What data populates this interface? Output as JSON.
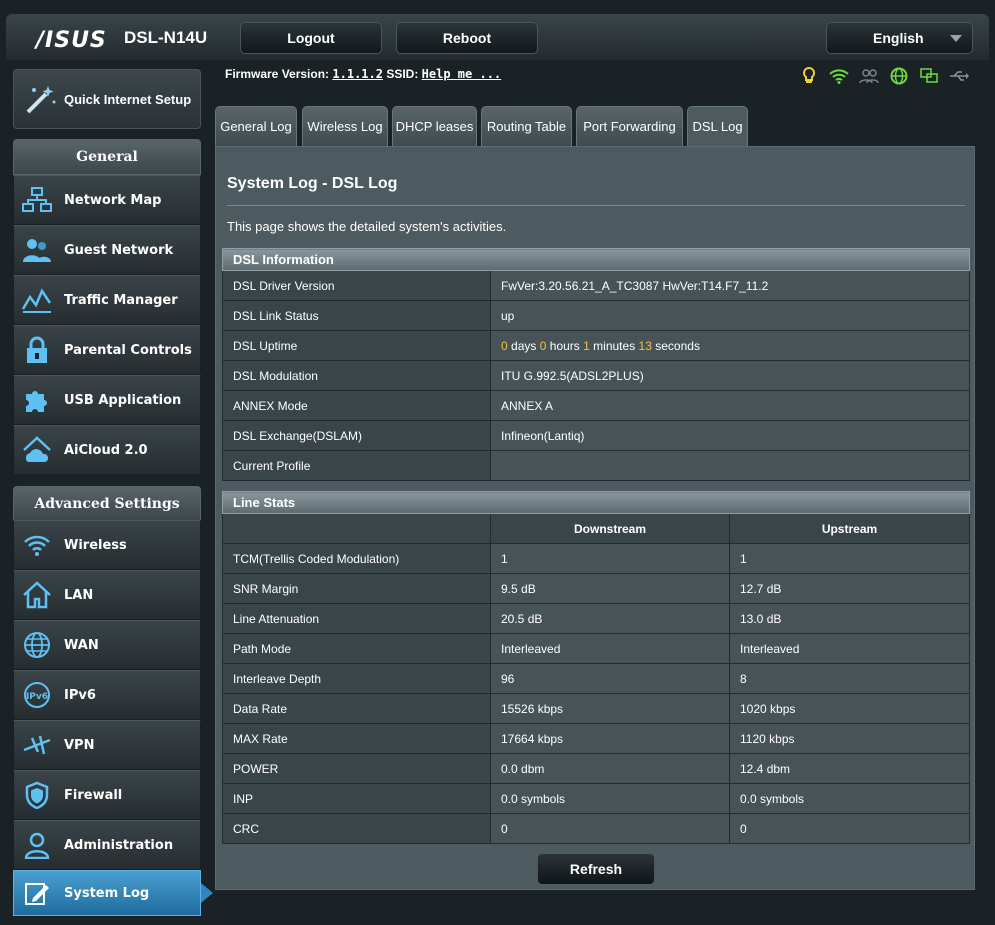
{
  "header": {
    "brand": "/ISUS",
    "model": "DSL-N14U",
    "logout_label": "Logout",
    "reboot_label": "Reboot",
    "language": "English"
  },
  "info_row": {
    "firmware_label": "Firmware Version:",
    "firmware_value": "1.1.1.2",
    "ssid_label": "SSID:",
    "ssid_value": "Help me ..."
  },
  "status_icons": [
    "lightbulb-icon",
    "wifi-icon",
    "clients-icon",
    "internet-globe-icon",
    "network-icon",
    "usb-icon"
  ],
  "sidebar": {
    "quick_setup": "Quick Internet Setup",
    "general_heading": "General",
    "general_items": [
      {
        "label": "Network Map",
        "icon": "network-map-icon"
      },
      {
        "label": "Guest Network",
        "icon": "guest-network-icon"
      },
      {
        "label": "Traffic Manager",
        "icon": "traffic-manager-icon"
      },
      {
        "label": "Parental Controls",
        "icon": "lock-icon"
      },
      {
        "label": "USB Application",
        "icon": "puzzle-icon"
      },
      {
        "label": "AiCloud 2.0",
        "icon": "cloud-icon"
      }
    ],
    "advanced_heading": "Advanced Settings",
    "advanced_items": [
      {
        "label": "Wireless",
        "icon": "wifi-icon"
      },
      {
        "label": "LAN",
        "icon": "home-icon"
      },
      {
        "label": "WAN",
        "icon": "globe-icon"
      },
      {
        "label": "IPv6",
        "icon": "ipv6-icon"
      },
      {
        "label": "VPN",
        "icon": "vpn-icon"
      },
      {
        "label": "Firewall",
        "icon": "shield-icon"
      },
      {
        "label": "Administration",
        "icon": "user-icon"
      },
      {
        "label": "System Log",
        "icon": "log-icon"
      }
    ]
  },
  "tabs": [
    "General Log",
    "Wireless Log",
    "DHCP leases",
    "Routing Table",
    "Port Forwarding",
    "DSL Log"
  ],
  "page": {
    "title": "System Log - DSL Log",
    "description": "This page shows the detailed system's activities."
  },
  "dsl_info": {
    "caption": "DSL Information",
    "rows": [
      {
        "key": "DSL Driver Version",
        "value": "FwVer:3.20.56.21_A_TC3087 HwVer:T14.F7_11.2"
      },
      {
        "key": "DSL Link Status",
        "value": "up"
      },
      {
        "key": "DSL Uptime",
        "value": ""
      },
      {
        "key": "DSL Modulation",
        "value": "ITU G.992.5(ADSL2PLUS)"
      },
      {
        "key": "ANNEX Mode",
        "value": "ANNEX A"
      },
      {
        "key": "DSL Exchange(DSLAM)",
        "value": "Infineon(Lantiq)"
      },
      {
        "key": "Current Profile",
        "value": ""
      }
    ],
    "uptime": {
      "days": "0",
      "days_label": "days",
      "hours": "0",
      "hours_label": "hours",
      "minutes": "1",
      "minutes_label": "minutes",
      "seconds": "13",
      "seconds_label": "seconds"
    }
  },
  "line_stats": {
    "caption": "Line Stats",
    "downstream_label": "Downstream",
    "upstream_label": "Upstream",
    "rows": [
      {
        "key": "TCM(Trellis Coded Modulation)",
        "down": "1",
        "up": "1"
      },
      {
        "key": "SNR Margin",
        "down": "9.5 dB",
        "up": "12.7 dB"
      },
      {
        "key": "Line Attenuation",
        "down": "20.5 dB",
        "up": "13.0 dB"
      },
      {
        "key": "Path Mode",
        "down": "Interleaved",
        "up": "Interleaved"
      },
      {
        "key": "Interleave Depth",
        "down": "96",
        "up": "8"
      },
      {
        "key": "Data Rate",
        "down": "15526 kbps",
        "up": "1020 kbps"
      },
      {
        "key": "MAX Rate",
        "down": "17664 kbps",
        "up": "1120 kbps"
      },
      {
        "key": "POWER",
        "down": "0.0 dbm",
        "up": "12.4 dbm"
      },
      {
        "key": "INP",
        "down": "0.0 symbols",
        "up": "0.0 symbols"
      },
      {
        "key": "CRC",
        "down": "0",
        "up": "0"
      }
    ]
  },
  "refresh_label": "Refresh",
  "colors": {
    "accent_active": "#2d86bf",
    "highlight": "#f5c242",
    "status_green": "#6dd93f"
  }
}
